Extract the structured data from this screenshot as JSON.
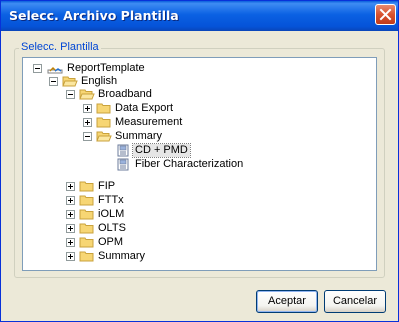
{
  "window": {
    "title": "Selecc. Archivo Plantilla"
  },
  "group": {
    "label": "Selecc. Plantilla"
  },
  "tree": {
    "root": "ReportTemplate",
    "english": "English",
    "broadband": "Broadband",
    "data_export": "Data Export",
    "measurement": "Measurement",
    "summary": "Summary",
    "cd_pmd": "CD + PMD",
    "fiber_char": "Fiber Characterization",
    "fip": "FIP",
    "fttx": "FTTx",
    "iolm": "iOLM",
    "olts": "OLTS",
    "opm": "OPM",
    "summary2": "Summary"
  },
  "buttons": {
    "ok": "Aceptar",
    "cancel": "Cancelar"
  },
  "icons": {
    "close": "close-icon",
    "folder": "folder-icon",
    "doc": "template-file-icon",
    "root": "report-root-icon"
  },
  "colors": {
    "titlebar": "#0553d8",
    "group_label": "#0046d5",
    "folder": "#f7d674"
  }
}
